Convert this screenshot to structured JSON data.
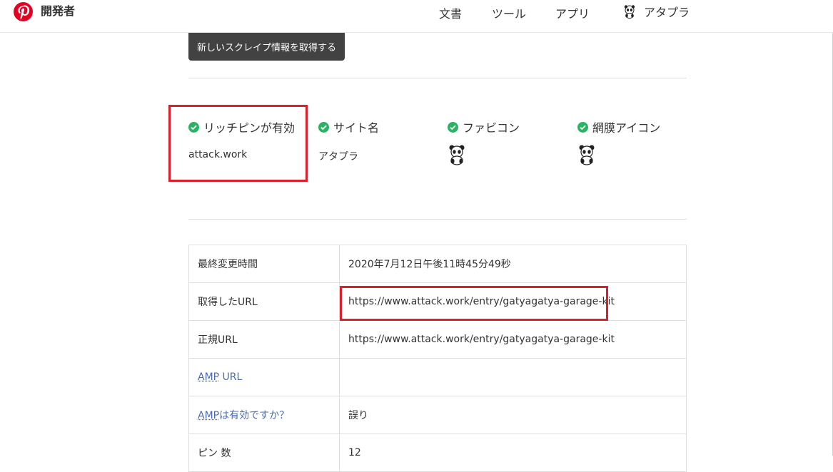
{
  "header": {
    "brand_name": "開発者",
    "nav": [
      "文書",
      "ツール",
      "アプリ"
    ],
    "account_name": "アタプラ"
  },
  "actions": {
    "scrape_label": "新しいスクレイプ情報を取得する"
  },
  "status": [
    {
      "label": "リッチピンが有効",
      "value": "attack.work",
      "icon": "check-circle-icon"
    },
    {
      "label": "サイト名",
      "value": "アタプラ",
      "icon": "check-circle-icon"
    },
    {
      "label": "ファビコン",
      "value": "",
      "icon": "check-circle-icon",
      "image": "panda-favicon"
    },
    {
      "label": "網膜アイコン",
      "value": "",
      "icon": "check-circle-icon",
      "image": "panda-retina-icon"
    }
  ],
  "table": {
    "rows": [
      {
        "key": "最終変更時間",
        "value": "2020年7月12日午後11時45分49秒"
      },
      {
        "key": "取得したURL",
        "value": "https://www.attack.work/entry/gatyagatya-garage-kit"
      },
      {
        "key": "正規URL",
        "value": "https://www.attack.work/entry/gatyagatya-garage-kit"
      },
      {
        "key_abbr": "AMP",
        "key_rest": " URL",
        "value": ""
      },
      {
        "key_abbr": "AMP",
        "key_rest": "は有効ですか？",
        "value": "誤り"
      },
      {
        "key": "ピン 数",
        "value": "12"
      }
    ]
  },
  "colors": {
    "brand_red": "#e60023",
    "check_green": "#28b463",
    "highlight_red": "#d9202b",
    "button_dark": "#424242",
    "link_blue": "#4a6bb3"
  }
}
